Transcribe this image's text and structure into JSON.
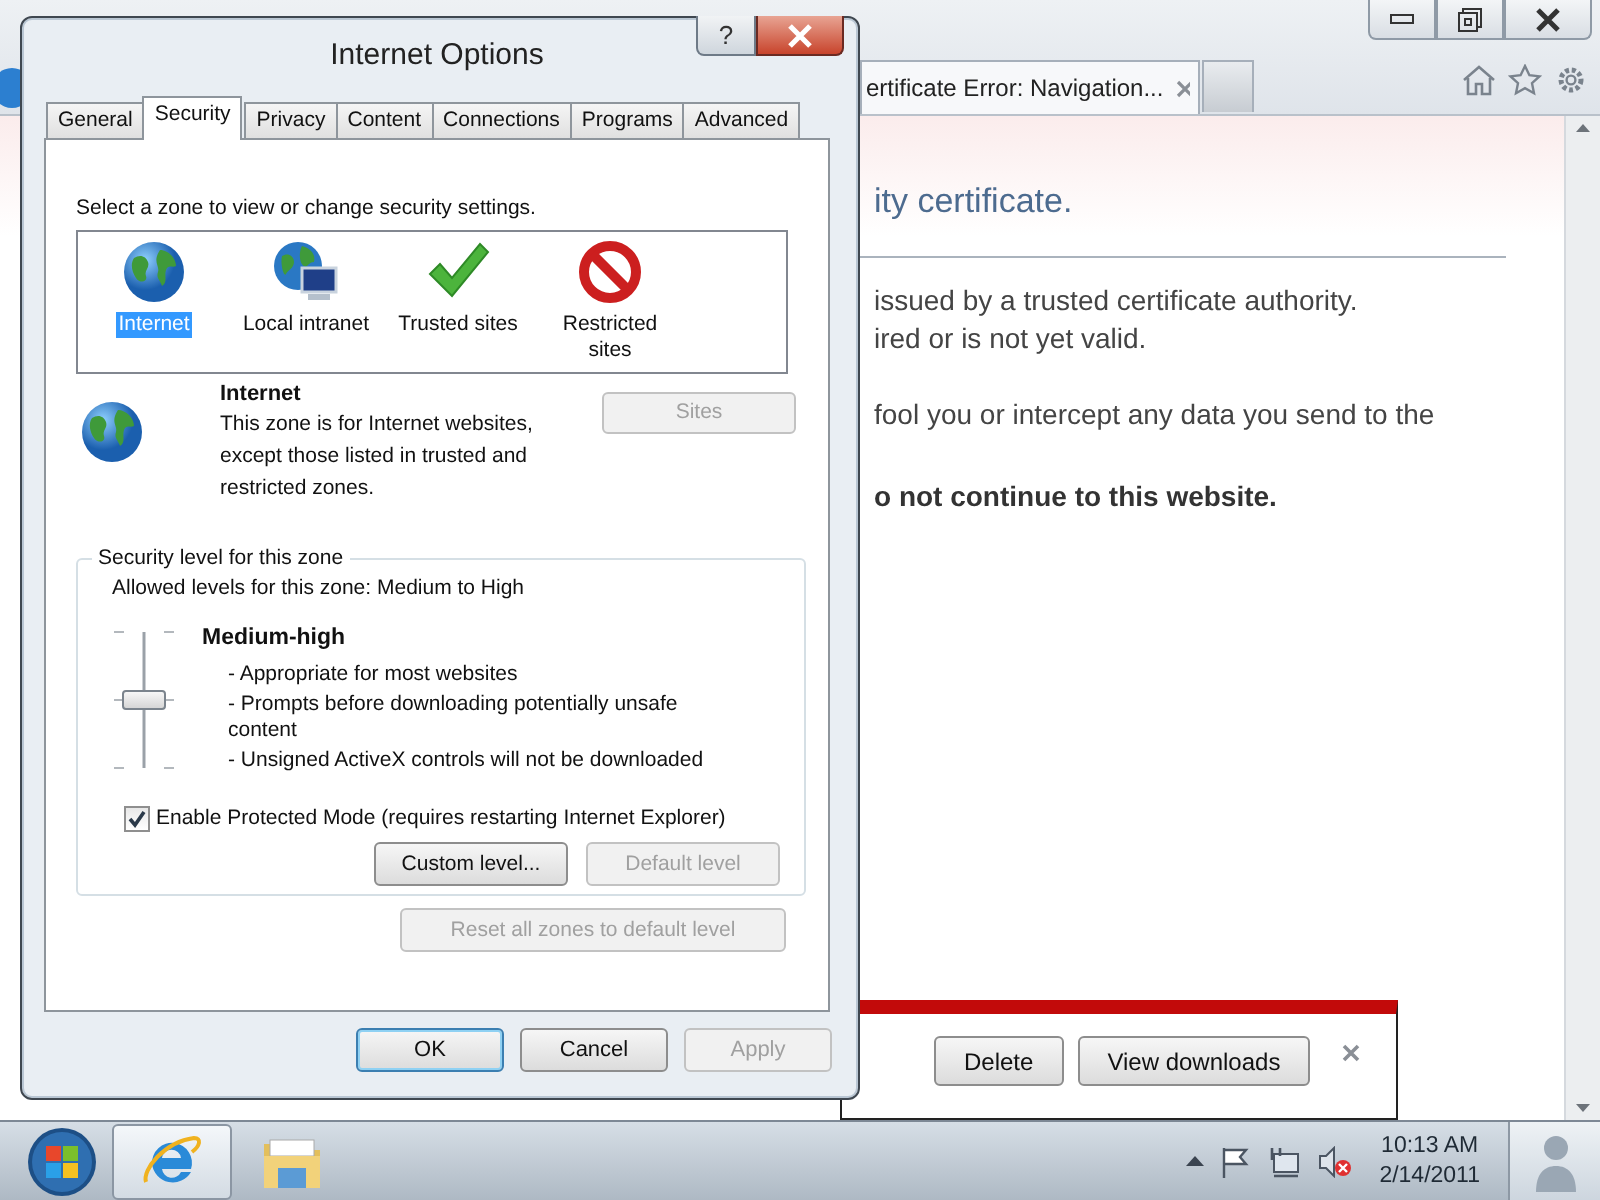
{
  "browser": {
    "tab_title": "ertificate Error: Navigation...",
    "content": {
      "heading": "ity certificate.",
      "paragraphs": [
        [
          "issued by a trusted certificate authority.",
          "ired or is not yet valid."
        ],
        [
          "fool you or intercept any data you send to the"
        ]
      ],
      "warning": "o not continue to this website."
    },
    "download_bar": {
      "buttons": [
        "Delete",
        "View downloads"
      ]
    }
  },
  "dialog": {
    "title": "Internet Options",
    "help_label": "?",
    "tabs": [
      {
        "label": "General",
        "selected": false
      },
      {
        "label": "Security",
        "selected": true
      },
      {
        "label": "Privacy",
        "selected": false
      },
      {
        "label": "Content",
        "selected": false
      },
      {
        "label": "Connections",
        "selected": false
      },
      {
        "label": "Programs",
        "selected": false
      },
      {
        "label": "Advanced",
        "selected": false
      }
    ],
    "zone_prompt": "Select a zone to view or change security settings.",
    "zones": [
      {
        "kind": "globe",
        "label": "Internet",
        "selected": true
      },
      {
        "kind": "intranet",
        "label": "Local intranet",
        "selected": false
      },
      {
        "kind": "check",
        "label": "Trusted sites",
        "selected": false
      },
      {
        "kind": "restricted",
        "label": "Restricted sites",
        "selected": false
      }
    ],
    "zone_info": {
      "name": "Internet",
      "description": "This zone is for Internet websites, except those listed in trusted and restricted zones.",
      "sites_button": {
        "label": "Sites",
        "disabled": true
      }
    },
    "security_level": {
      "title": "Security level for this zone",
      "allowed": "Allowed levels for this zone: Medium to High",
      "level": 0.5,
      "name": "Medium-high",
      "bullets": [
        "- Appropriate for most websites",
        "- Prompts before downloading potentially unsafe content",
        "- Unsigned ActiveX controls will not be downloaded"
      ],
      "protected_mode": {
        "label": "Enable Protected Mode (requires restarting Internet Explorer)",
        "checked": true
      },
      "buttons": [
        {
          "label": "Custom level...",
          "disabled": false
        },
        {
          "label": "Default level",
          "disabled": true
        }
      ]
    },
    "reset_button": {
      "label": "Reset all zones to default level",
      "disabled": true
    },
    "footer_buttons": [
      {
        "label": "OK",
        "disabled": false,
        "default": true
      },
      {
        "label": "Cancel",
        "disabled": false,
        "default": false
      },
      {
        "label": "Apply",
        "disabled": true,
        "default": false
      }
    ]
  },
  "taskbar": {
    "time": "10:13 AM",
    "date": "2/14/2011"
  }
}
